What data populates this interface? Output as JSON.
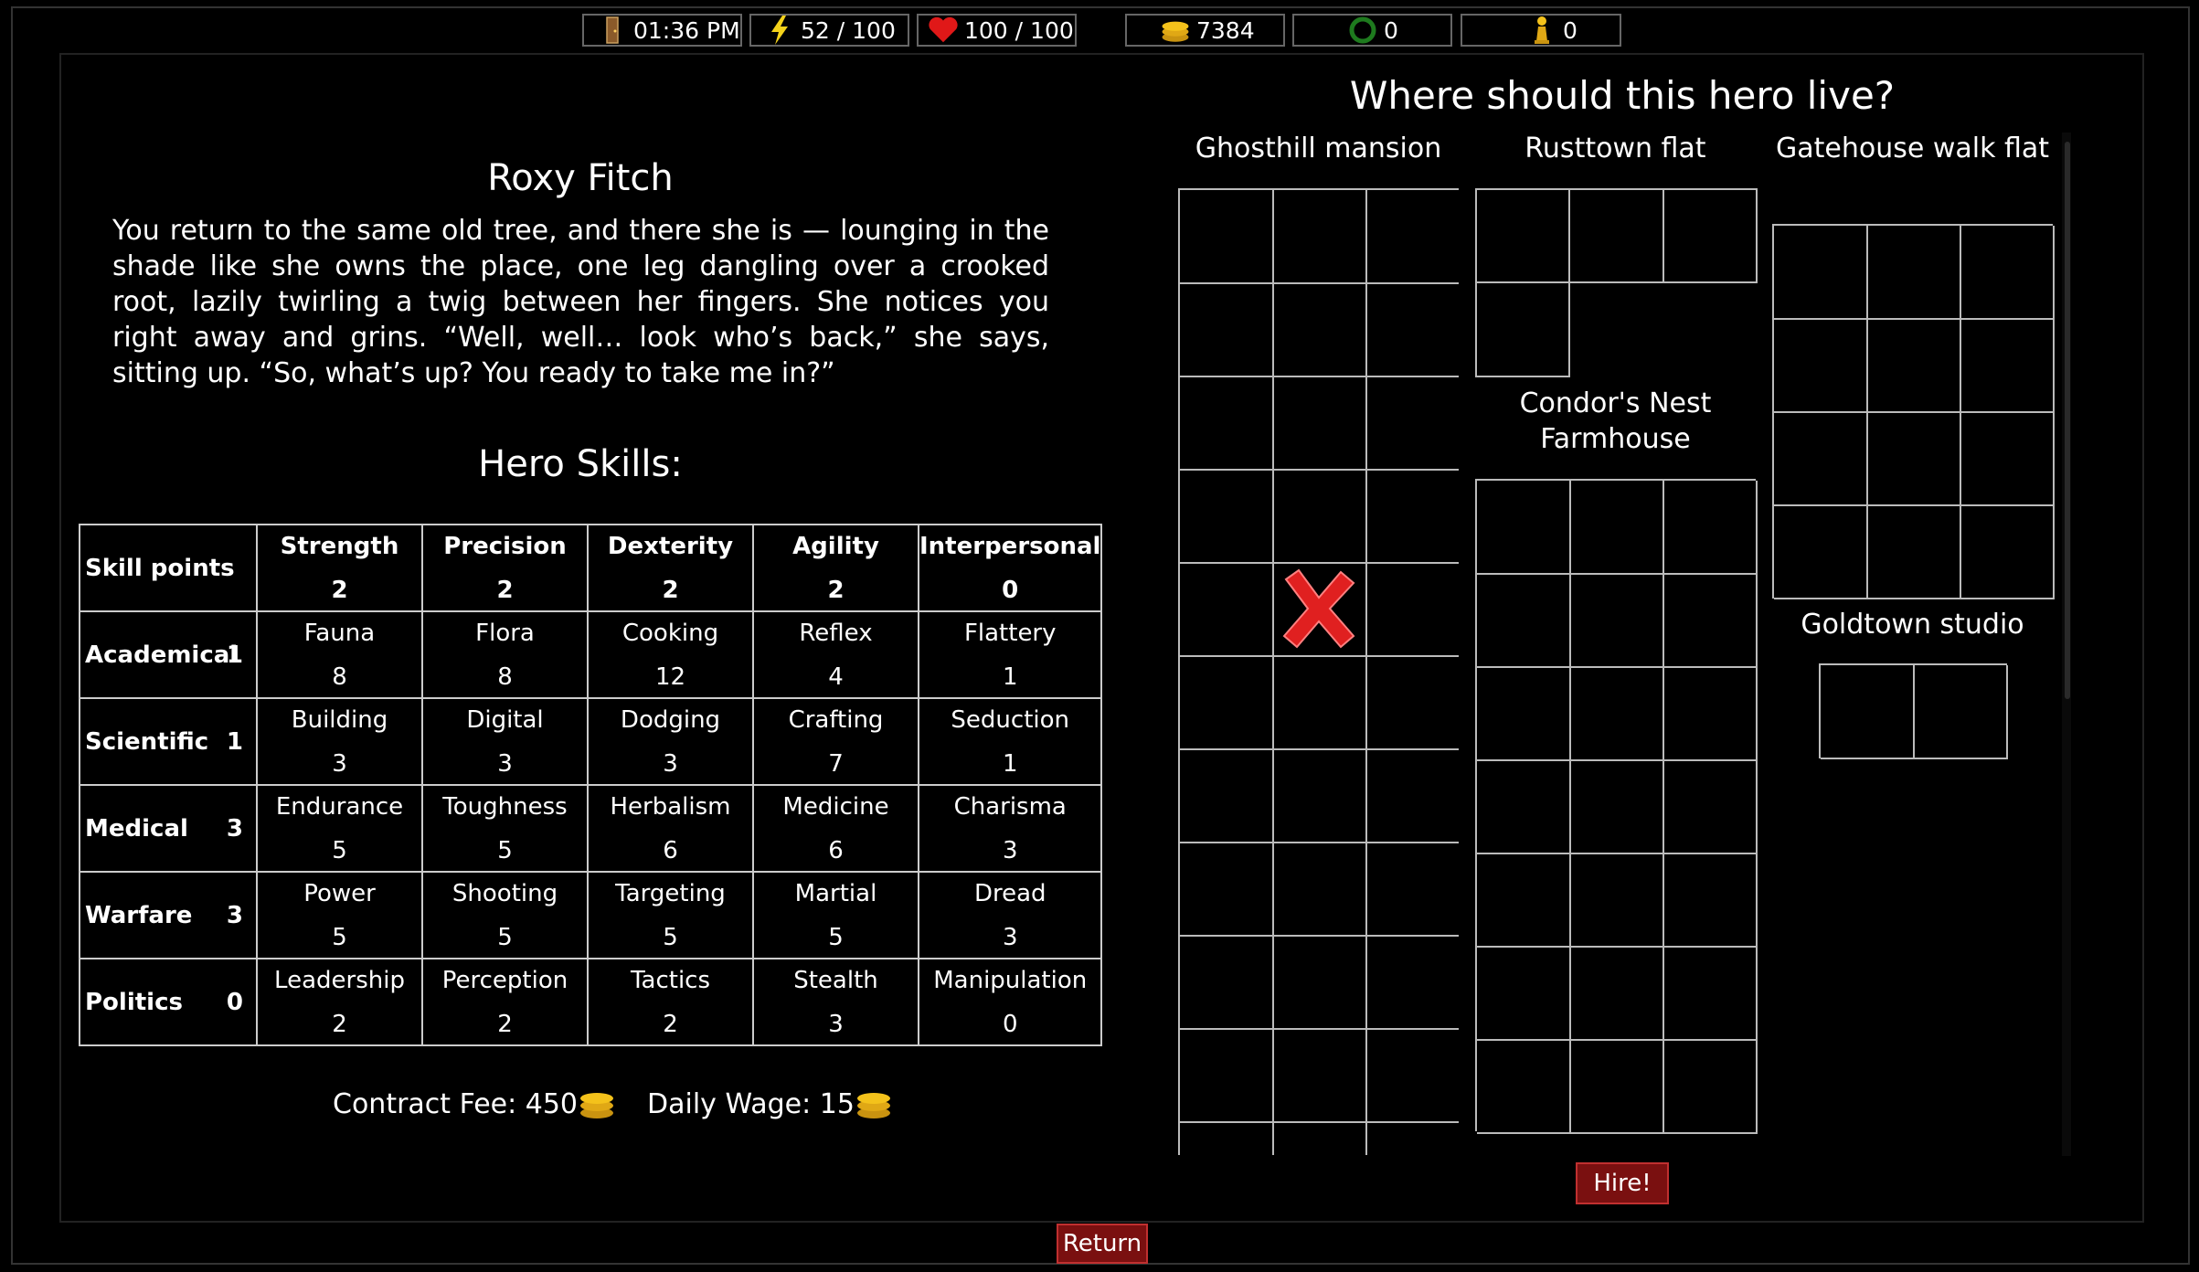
{
  "status_bar": {
    "time": "01:36 PM",
    "energy": "52 / 100",
    "health": "100 / 100",
    "gold": "7384",
    "wreath": "0",
    "pawn": "0"
  },
  "hero": {
    "name": "Roxy Fitch",
    "story": "You return to the same old tree, and there she is — lounging in the shade like she owns the place, one leg dangling over a crooked root, lazily twirling a twig between her fingers. She notices you right away and grins. “Well, well… look who’s back,” she says, sitting up. “So, what’s up? You ready to take me in?”"
  },
  "skills": {
    "title": "Hero Skills:",
    "header": {
      "label": "Skill points",
      "columns": [
        {
          "name": "Strength",
          "value": "2"
        },
        {
          "name": "Precision",
          "value": "2"
        },
        {
          "name": "Dexterity",
          "value": "2"
        },
        {
          "name": "Agility",
          "value": "2"
        },
        {
          "name": "Interpersonal",
          "value": "0"
        }
      ]
    },
    "rows": [
      {
        "label": "Academical",
        "points": "1",
        "cells": [
          {
            "name": "Fauna",
            "value": "8"
          },
          {
            "name": "Flora",
            "value": "8"
          },
          {
            "name": "Cooking",
            "value": "12"
          },
          {
            "name": "Reflex",
            "value": "4"
          },
          {
            "name": "Flattery",
            "value": "1"
          }
        ]
      },
      {
        "label": "Scientific",
        "points": "1",
        "cells": [
          {
            "name": "Building",
            "value": "3"
          },
          {
            "name": "Digital",
            "value": "3"
          },
          {
            "name": "Dodging",
            "value": "3"
          },
          {
            "name": "Crafting",
            "value": "7"
          },
          {
            "name": "Seduction",
            "value": "1"
          }
        ]
      },
      {
        "label": "Medical",
        "points": "3",
        "cells": [
          {
            "name": "Endurance",
            "value": "5"
          },
          {
            "name": "Toughness",
            "value": "5"
          },
          {
            "name": "Herbalism",
            "value": "6"
          },
          {
            "name": "Medicine",
            "value": "6"
          },
          {
            "name": "Charisma",
            "value": "3"
          }
        ]
      },
      {
        "label": "Warfare",
        "points": "3",
        "cells": [
          {
            "name": "Power",
            "value": "5"
          },
          {
            "name": "Shooting",
            "value": "5"
          },
          {
            "name": "Targeting",
            "value": "5"
          },
          {
            "name": "Martial",
            "value": "5"
          },
          {
            "name": "Dread",
            "value": "3"
          }
        ]
      },
      {
        "label": "Politics",
        "points": "0",
        "cells": [
          {
            "name": "Leadership",
            "value": "2"
          },
          {
            "name": "Perception",
            "value": "2"
          },
          {
            "name": "Tactics",
            "value": "2"
          },
          {
            "name": "Stealth",
            "value": "3"
          },
          {
            "name": "Manipulation",
            "value": "0"
          }
        ]
      }
    ]
  },
  "fees": {
    "contract_label": "Contract Fee: 450",
    "wage_label": "Daily Wage: 15"
  },
  "housing": {
    "title": "Where should this hero live?",
    "houses": [
      {
        "name": "Ghosthill mansion",
        "slots": 33,
        "marked_slot": 13
      },
      {
        "name": "Rusttown flat",
        "slots": 4
      },
      {
        "name": "Gatehouse walk flat",
        "slots": 12
      },
      {
        "name": "Condor's Nest Farmhouse",
        "slots": 21
      },
      {
        "name": "Goldtown studio",
        "slots": 2
      }
    ]
  },
  "buttons": {
    "hire": "Hire!",
    "return": "Return"
  },
  "colors": {
    "button_bg": "#7a1010",
    "gold": "#f4c21b",
    "energy": "#f4d21b",
    "health": "#e01818",
    "wreath": "#1e7a1e",
    "x_mark": "#e02020"
  }
}
